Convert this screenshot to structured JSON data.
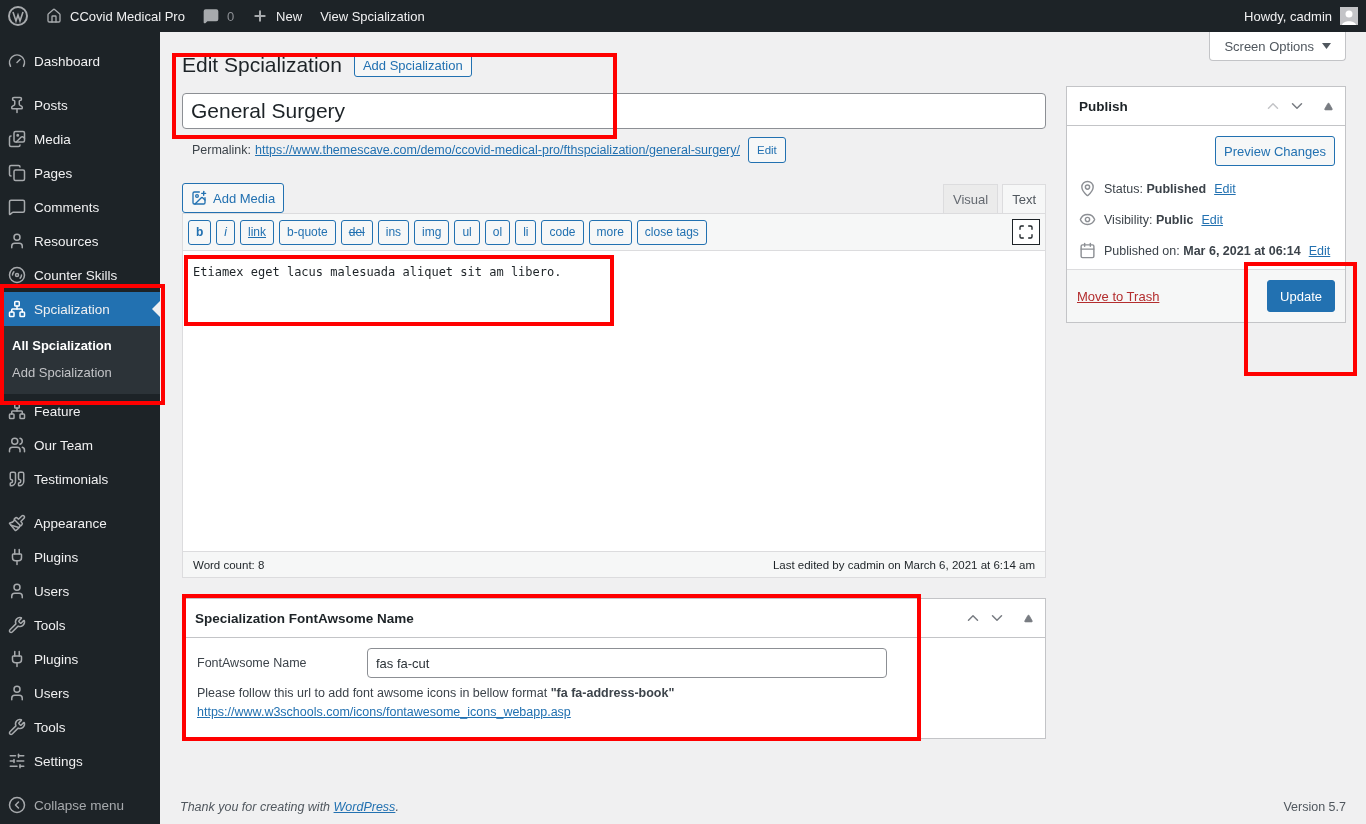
{
  "admin_bar": {
    "site_name": "CCovid Medical Pro",
    "comments_count": "0",
    "new_label": "New",
    "view_label": "View Spcialization",
    "greeting": "Howdy, cadmin"
  },
  "sidebar": {
    "groups": [
      [
        {
          "label": "Dashboard",
          "selected": false
        }
      ],
      [
        {
          "label": "Posts",
          "selected": false
        },
        {
          "label": "Media",
          "selected": false
        },
        {
          "label": "Pages",
          "selected": false
        },
        {
          "label": "Comments",
          "selected": false
        },
        {
          "label": "Resources",
          "selected": false
        },
        {
          "label": "Counter Skills",
          "selected": false
        },
        {
          "label": "Spcialization",
          "selected": true,
          "children": [
            {
              "label": "All Spcialization",
              "selected": true
            },
            {
              "label": "Add Spcialization",
              "selected": false
            }
          ]
        },
        {
          "label": "Feature",
          "selected": false
        },
        {
          "label": "Our Team",
          "selected": false
        },
        {
          "label": "Testimonials",
          "selected": false
        }
      ],
      [
        {
          "label": "Appearance",
          "selected": false
        },
        {
          "label": "Plugins",
          "selected": false
        },
        {
          "label": "Users",
          "selected": false
        },
        {
          "label": "Tools",
          "selected": false
        },
        {
          "label": "Plugins",
          "selected": false
        },
        {
          "label": "Users",
          "selected": false
        },
        {
          "label": "Tools",
          "selected": false
        },
        {
          "label": "Settings",
          "selected": false
        }
      ]
    ],
    "collapse_label": "Collapse menu"
  },
  "screen_options": "Screen Options",
  "heading": "Edit Spcialization",
  "add_new_button": "Add Spcialization",
  "title_field": {
    "value": "General Surgery"
  },
  "permalink": {
    "label": "Permalink:",
    "url": "https://www.themescave.com/demo/ccovid-medical-pro/fthspcialization/general-surgery/",
    "edit_button": "Edit"
  },
  "editor": {
    "add_media": "Add Media",
    "tabs": [
      {
        "label": "Visual",
        "selected": false
      },
      {
        "label": "Text",
        "selected": true
      }
    ],
    "toolbar": [
      {
        "label": "b",
        "kind": "bold"
      },
      {
        "label": "i",
        "kind": "italic"
      },
      {
        "label": "link",
        "kind": "underline"
      },
      {
        "label": "b-quote",
        "kind": "plain"
      },
      {
        "label": "del",
        "kind": "strike"
      },
      {
        "label": "ins",
        "kind": "plain"
      },
      {
        "label": "img",
        "kind": "plain"
      },
      {
        "label": "ul",
        "kind": "plain"
      },
      {
        "label": "ol",
        "kind": "plain"
      },
      {
        "label": "li",
        "kind": "plain"
      },
      {
        "label": "code",
        "kind": "plain"
      },
      {
        "label": "more",
        "kind": "plain"
      },
      {
        "label": "close tags",
        "kind": "plain"
      }
    ],
    "content": "Etiamex eget lacus malesuada aliquet sit am libero.",
    "word_count": "Word count: 8",
    "last_edited": "Last edited by cadmin on March 6, 2021 at 6:14 am"
  },
  "meta_box": {
    "title": "Specialization FontAwsome Name",
    "field_label": "FontAwsome Name",
    "field_value": "fas fa-cut",
    "help": "Please follow this url to add font awsome icons in bellow format **\"fa fa-address-book\"**",
    "help_link": "https://www.w3schools.com/icons/fontawesome_icons_webapp.asp"
  },
  "publish": {
    "title": "Publish",
    "preview_button": "Preview Changes",
    "rows": [
      {
        "label": "Status:",
        "value": "Published",
        "link": "Edit"
      },
      {
        "label": "Visibility:",
        "value": "Public",
        "link": "Edit"
      },
      {
        "label": "Published on:",
        "value": "Mar 6, 2021 at 06:14",
        "link": "Edit"
      }
    ],
    "trash_link": "Move to Trash",
    "update_button": "Update"
  },
  "footer": {
    "text": "Thank you for creating with ",
    "link": "WordPress",
    "end": ".",
    "version": "Version 5.7"
  },
  "highlights": [
    {
      "kind": "title"
    },
    {
      "kind": "menu"
    },
    {
      "kind": "content"
    },
    {
      "kind": "update"
    },
    {
      "kind": "metabox"
    }
  ]
}
